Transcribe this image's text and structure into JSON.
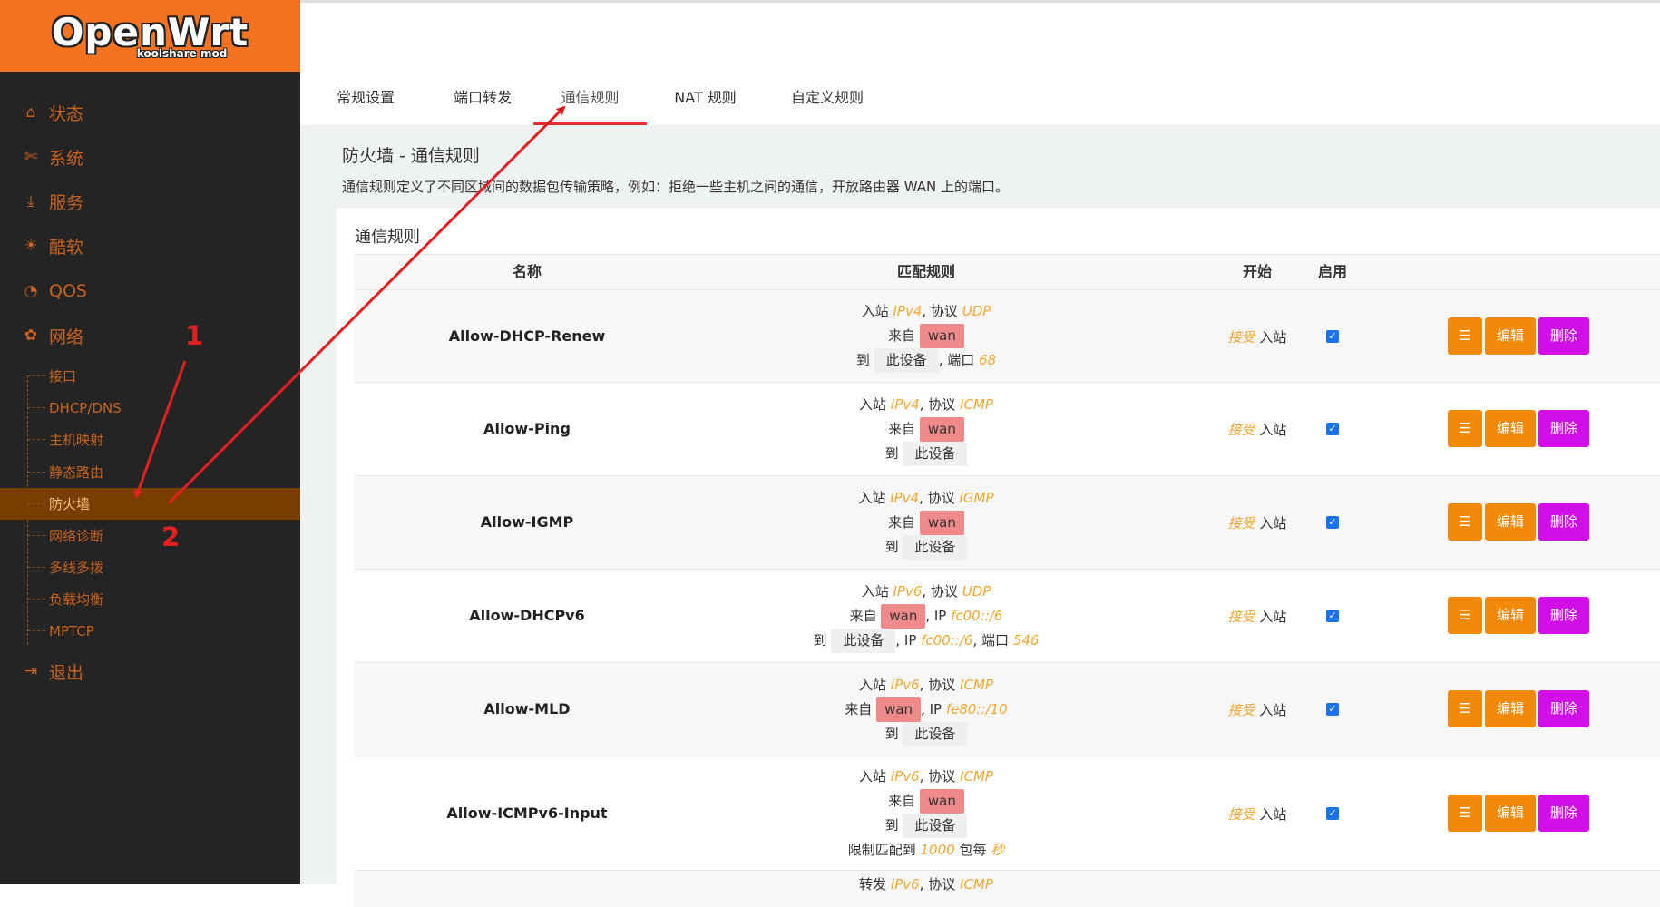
{
  "logo": {
    "brand": "OpenWrt",
    "sub": "koolshare mod"
  },
  "sidebar": {
    "top_items": [
      {
        "label": "状态",
        "icon": "home-icon",
        "glyph": "⌂"
      },
      {
        "label": "系统",
        "icon": "tools-icon",
        "glyph": "✄"
      },
      {
        "label": "服务",
        "icon": "download-icon",
        "glyph": "⤓"
      },
      {
        "label": "酷软",
        "icon": "weibo-icon",
        "glyph": "☀"
      },
      {
        "label": "QOS",
        "icon": "gauge-icon",
        "glyph": "◔"
      },
      {
        "label": "网络",
        "icon": "network-icon",
        "glyph": "✿"
      }
    ],
    "sub_items": [
      "接口",
      "DHCP/DNS",
      "主机映射",
      "静态路由",
      "防火墙",
      "网络诊断",
      "多线多拨",
      "负载均衡",
      "MPTCP"
    ],
    "logout": {
      "label": "退出",
      "icon": "logout-icon",
      "glyph": "⇥"
    }
  },
  "annotations": {
    "one": "1",
    "two": "2"
  },
  "tabs": [
    "常规设置",
    "端口转发",
    "通信规则",
    "NAT 规则",
    "自定义规则"
  ],
  "page": {
    "title": "防火墙 - 通信规则",
    "description": "通信规则定义了不同区域间的数据包传输策略，例如：拒绝一些主机之间的通信，开放路由器 WAN 上的端口。",
    "section_title": "通信规则"
  },
  "table": {
    "headers": {
      "name": "名称",
      "match": "匹配规则",
      "start": "开始",
      "enable": "启用"
    },
    "words": {
      "inbound": "入站",
      "forward": "转发",
      "protocol": "协议",
      "from": "来自",
      "to": "到",
      "port": "端口",
      "device": "此设备",
      "accept": "接受",
      "limit": "限制匹配到",
      "per": "包每",
      "second": "秒"
    },
    "buttons": {
      "sort": "☰",
      "edit": "编辑",
      "delete": "删除"
    },
    "rows": [
      {
        "name": "Allow-DHCP-Renew",
        "family": "IPv4",
        "proto": "UDP",
        "src": "wan",
        "dest_port": "68"
      },
      {
        "name": "Allow-Ping",
        "family": "IPv4",
        "proto": "ICMP",
        "src": "wan"
      },
      {
        "name": "Allow-IGMP",
        "family": "IPv4",
        "proto": "IGMP",
        "src": "wan"
      },
      {
        "name": "Allow-DHCPv6",
        "family": "IPv6",
        "proto": "UDP",
        "src": "wan",
        "src_ip": "fc00::/6",
        "dest_ip": "fc00::/6",
        "dest_port": "546"
      },
      {
        "name": "Allow-MLD",
        "family": "IPv6",
        "proto": "ICMP",
        "src": "wan",
        "src_ip": "fe80::/10"
      },
      {
        "name": "Allow-ICMPv6-Input",
        "family": "IPv6",
        "proto": "ICMP",
        "src": "wan",
        "limit": "1000"
      },
      {
        "name": "",
        "family": "IPv6",
        "proto": "ICMP",
        "forward": true
      }
    ]
  }
}
